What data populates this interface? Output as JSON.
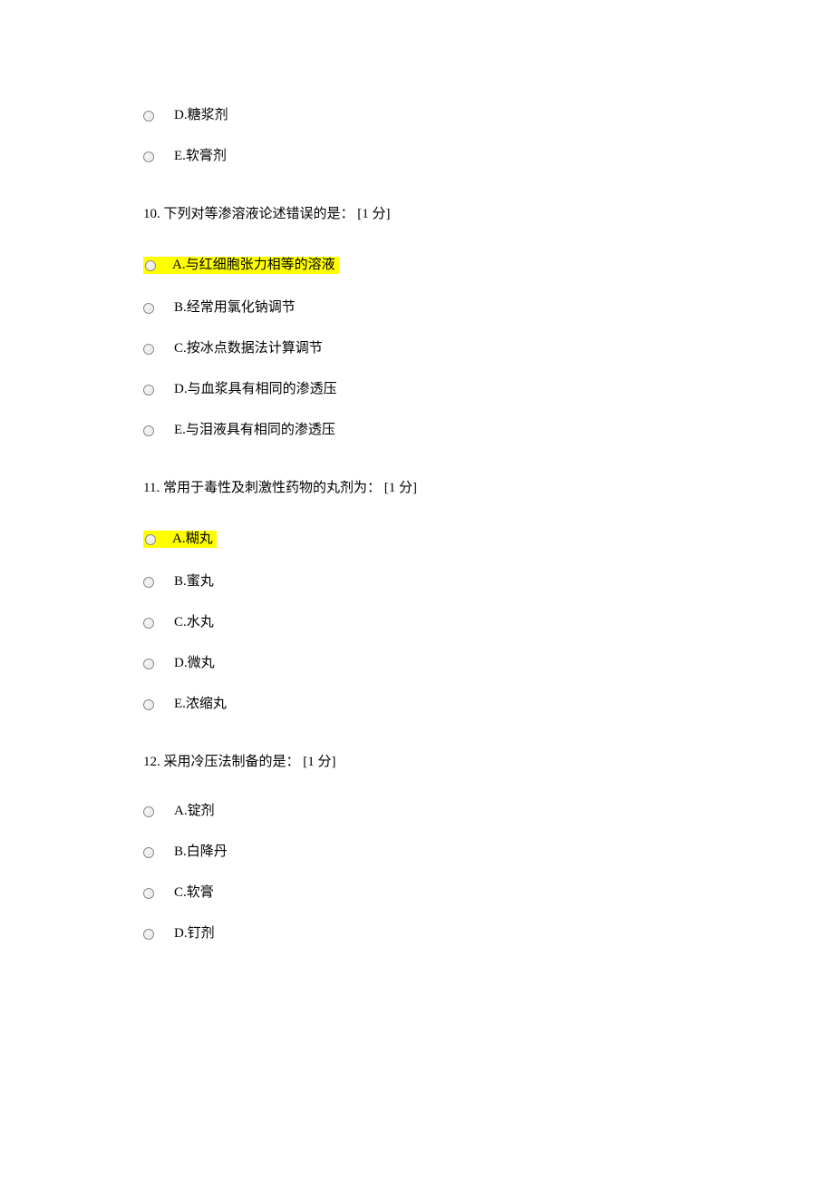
{
  "top_options": [
    {
      "label": "D.糖浆剂"
    },
    {
      "label": "E.软膏剂"
    }
  ],
  "q10": {
    "text": "10. 下列对等渗溶液论述错误的是： [1 分]",
    "options": [
      {
        "label": "A.与红细胞张力相等的溶液",
        "highlight": true
      },
      {
        "label": "B.经常用氯化钠调节"
      },
      {
        "label": "C.按冰点数据法计算调节"
      },
      {
        "label": "D.与血浆具有相同的渗透压"
      },
      {
        "label": "E.与泪液具有相同的渗透压"
      }
    ]
  },
  "q11": {
    "text": "11. 常用于毒性及刺激性药物的丸剂为： [1 分]",
    "options": [
      {
        "label": "A.糊丸",
        "highlight": true
      },
      {
        "label": "B.蜜丸"
      },
      {
        "label": "C.水丸"
      },
      {
        "label": "D.微丸"
      },
      {
        "label": "E.浓缩丸"
      }
    ]
  },
  "q12": {
    "text": "12. 采用冷压法制备的是： [1 分]",
    "options": [
      {
        "label": "A.锭剂"
      },
      {
        "label": "B.白降丹"
      },
      {
        "label": "C.软膏"
      },
      {
        "label": "D.钉剂"
      }
    ]
  }
}
